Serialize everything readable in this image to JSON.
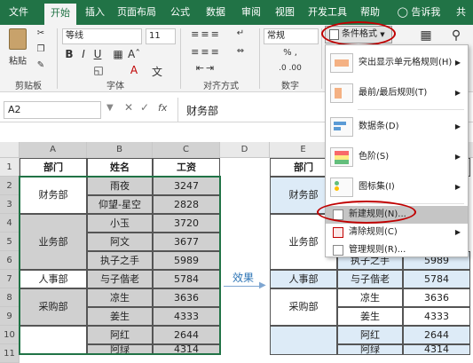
{
  "ribbon_tabs": [
    "文件",
    "开始",
    "插入",
    "页面布局",
    "公式",
    "数据",
    "审阅",
    "视图",
    "开发工具",
    "帮助",
    "告诉我",
    "共"
  ],
  "active_tab": "开始",
  "font": {
    "name": "等线",
    "size": "11"
  },
  "number_format": "常规",
  "conditional_format_button": "条件格式",
  "group_labels": {
    "clipboard": "剪贴板",
    "font": "字体",
    "alignment": "对齐方式",
    "number": "数字"
  },
  "paste_label": "粘贴",
  "font_buttons": {
    "bold": "B",
    "italic": "I",
    "underline": "U"
  },
  "name_box": "A2",
  "formula": "财务部",
  "fx_label": "fx",
  "columns_left": [
    "A",
    "B",
    "C",
    "D",
    "E"
  ],
  "row_numbers": [
    "1",
    "2",
    "3",
    "4",
    "5",
    "6",
    "7",
    "8",
    "9",
    "10",
    "11"
  ],
  "headers": {
    "dept": "部门",
    "name": "姓名",
    "salary": "工资"
  },
  "left_table": {
    "depts": [
      "财务部",
      "业务部",
      "人事部",
      "采购部"
    ],
    "rows": [
      {
        "name": "雨夜",
        "salary": "3247"
      },
      {
        "name": "仰望-星空",
        "salary": "2828"
      },
      {
        "name": "小玉",
        "salary": "3720"
      },
      {
        "name": "阿文",
        "salary": "3677"
      },
      {
        "name": "执子之手",
        "salary": "5989"
      },
      {
        "name": "与子偕老",
        "salary": "5784"
      },
      {
        "name": "凉生",
        "salary": "3636"
      },
      {
        "name": "姜生",
        "salary": "4333"
      },
      {
        "name": "阿红",
        "salary": "2644"
      },
      {
        "name": "阿绿",
        "salary": "4314"
      }
    ]
  },
  "right_table": {
    "depts": [
      "财务部",
      "业务部",
      "人事部",
      "采购部"
    ],
    "partial_row": {
      "name": "执子之手",
      "salary": "5989"
    },
    "rows": [
      {
        "name": "与子偕老",
        "salary": "5784"
      },
      {
        "name": "凉生",
        "salary": "3636"
      },
      {
        "name": "姜生",
        "salary": "4333"
      },
      {
        "name": "阿红",
        "salary": "2644"
      },
      {
        "name": "阿绿",
        "salary": "4314"
      }
    ]
  },
  "effect_label": "效果",
  "menu_items": [
    {
      "label": "突出显示单元格规则(H)",
      "has_sub": true
    },
    {
      "label": "最前/最后规则(T)",
      "has_sub": true
    },
    {
      "label": "数据条(D)",
      "has_sub": true
    },
    {
      "label": "色阶(S)",
      "has_sub": true
    },
    {
      "label": "图标集(I)",
      "has_sub": true
    },
    {
      "label": "新建规则(N)...",
      "has_sub": false
    },
    {
      "label": "清除规则(C)",
      "has_sub": true
    },
    {
      "label": "管理规则(R)...",
      "has_sub": false
    }
  ],
  "colors": {
    "excel_green": "#217346",
    "highlight": "#c00000",
    "cell_gray": "#d0d0d0",
    "cell_blue": "#ddebf7"
  }
}
